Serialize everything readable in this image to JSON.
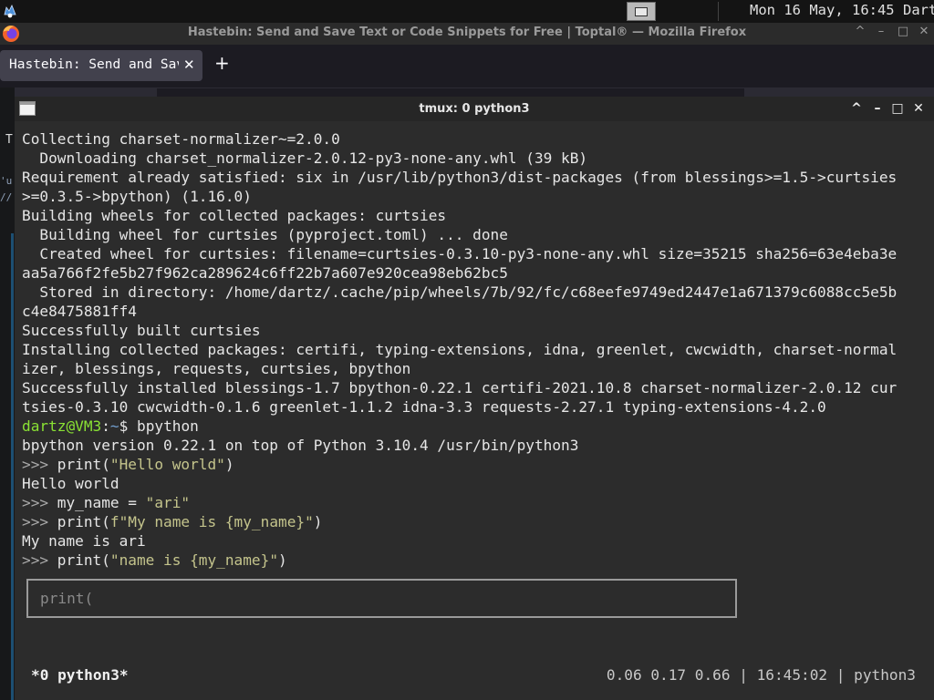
{
  "system_panel": {
    "clock": "Mon 16 May, 16:45",
    "user": "Dartz",
    "left_icon": "desktop-launcher-icon",
    "window_button_icon": "window-list-icon"
  },
  "firefox": {
    "window_title": "Hastebin: Send and Save Text or Code Snippets for Free | Toptal® — Mozilla Firefox",
    "tab_label": "Hastebin: Send and Save Text or Code Snippets for Free | Toptal®",
    "tab_close": "✕",
    "new_tab": "+",
    "title_controls": [
      "^",
      "–",
      "□",
      "✕"
    ],
    "background_fragments": [
      "T",
      "'u",
      "//"
    ]
  },
  "terminal": {
    "window_title": "tmux: 0 python3",
    "controls": [
      "^",
      "–",
      "□",
      "✕"
    ],
    "lines": [
      "Collecting charset-normalizer~=2.0.0",
      "  Downloading charset_normalizer-2.0.12-py3-none-any.whl (39 kB)",
      "Requirement already satisfied: six in /usr/lib/python3/dist-packages (from blessings>=1.5->curtsies",
      ">=0.3.5->bpython) (1.16.0)",
      "Building wheels for collected packages: curtsies",
      "  Building wheel for curtsies (pyproject.toml) ... done",
      "  Created wheel for curtsies: filename=curtsies-0.3.10-py3-none-any.whl size=35215 sha256=63e4eba3e",
      "aa5a766f2fe5b27f962ca289624c6ff22b7a607e920cea98eb62bc5",
      "  Stored in directory: /home/dartz/.cache/pip/wheels/7b/92/fc/c68eefe9749ed2447e1a671379c6088cc5e5b",
      "c4e8475881ff4",
      "Successfully built curtsies",
      "Installing collected packages: certifi, typing-extensions, idna, greenlet, cwcwidth, charset-normal",
      "izer, blessings, requests, curtsies, bpython",
      "Successfully installed blessings-1.7 bpython-0.22.1 certifi-2021.10.8 charset-normalizer-2.0.12 cur",
      "tsies-0.3.10 cwcwidth-0.1.6 greenlet-1.1.2 idna-3.3 requests-2.27.1 typing-extensions-4.2.0"
    ],
    "shell_prompt": {
      "userhost": "dartz@VM3",
      "sep": ":",
      "cwd": "~",
      "sign": "$ ",
      "command": "bpython"
    },
    "bpython_banner": "bpython version 0.22.1 on top of Python 3.10.4 /usr/bin/python3",
    "repl_prompt": ">>> ",
    "repl": [
      {
        "code_prefix": "print(",
        "string": "\"Hello world\"",
        "code_suffix": ")"
      },
      {
        "output": "Hello world"
      },
      {
        "code_prefix": "my_name = ",
        "string": "\"ari\"",
        "code_suffix": ""
      },
      {
        "code_prefix": "print(",
        "string": "f\"My name is {my_name}\"",
        "code_suffix": ")"
      },
      {
        "output": "My name is ari"
      },
      {
        "code_prefix": "print(",
        "string": "\"name is {my_name}\"",
        "code_suffix": ")"
      }
    ],
    "suggestion_box": "print(",
    "status_left": "*0 python3*",
    "status_right": "0.06 0.17 0.66 | 16:45:02 | python3"
  }
}
